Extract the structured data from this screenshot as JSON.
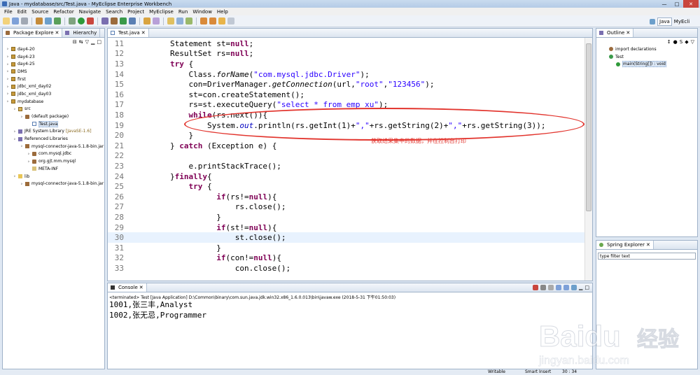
{
  "window": {
    "title": "Java - mydatabase/src/Test.java - MyEclipse Enterprise Workbench",
    "min": "—",
    "max": "□",
    "close": "✕"
  },
  "menu": [
    "File",
    "Edit",
    "Source",
    "Refactor",
    "Navigate",
    "Search",
    "Project",
    "MyEclipse",
    "Run",
    "Window",
    "Help"
  ],
  "perspectives": {
    "java": "Java",
    "myeclipse": "MyEcli"
  },
  "package_explorer": {
    "tabs": [
      "Package Explore",
      "Hierarchy"
    ],
    "items": [
      {
        "label": "day4-20",
        "type": "proj",
        "indent": 0
      },
      {
        "label": "day4-23",
        "type": "proj",
        "indent": 0
      },
      {
        "label": "day4-25",
        "type": "proj",
        "indent": 0
      },
      {
        "label": "DMS",
        "type": "proj",
        "indent": 0
      },
      {
        "label": "first",
        "type": "proj",
        "indent": 0
      },
      {
        "label": "jdbc_xml_day02",
        "type": "proj",
        "indent": 0
      },
      {
        "label": "jdbc_xml_day03",
        "type": "proj",
        "indent": 0
      },
      {
        "label": "mydatabase",
        "type": "proj",
        "indent": 0
      },
      {
        "label": "src",
        "type": "src",
        "indent": 1
      },
      {
        "label": "(default package)",
        "type": "pkg",
        "indent": 2
      },
      {
        "label": "Test.java",
        "type": "java",
        "indent": 3,
        "selected": true
      },
      {
        "label": "JRE System Library",
        "extra": "[JavaSE-1.6]",
        "type": "lib",
        "indent": 1
      },
      {
        "label": "Referenced Libraries",
        "type": "lib",
        "indent": 1
      },
      {
        "label": "mysql-connector-java-5.1.8-bin.jar",
        "type": "jar",
        "indent": 2
      },
      {
        "label": "com.mysql.jdbc",
        "type": "pkg",
        "indent": 3
      },
      {
        "label": "org.gjt.mm.mysql",
        "type": "pkg",
        "indent": 3
      },
      {
        "label": "META-INF",
        "type": "meta",
        "indent": 3
      },
      {
        "label": "lib",
        "type": "folder",
        "indent": 1
      },
      {
        "label": "mysql-connector-java-5.1.8-bin.jar",
        "type": "jar",
        "indent": 2
      }
    ]
  },
  "editor": {
    "tab": "Test.java",
    "annotation": "获取结果集中的数据，并在控制台打印",
    "current_line": 30,
    "lines": [
      {
        "n": "11",
        "parts": [
          {
            "t": "        Statement st="
          },
          {
            "t": "null",
            "c": "kw"
          },
          {
            "t": ";"
          }
        ]
      },
      {
        "n": "12",
        "parts": [
          {
            "t": "        ResultSet rs="
          },
          {
            "t": "null",
            "c": "kw"
          },
          {
            "t": ";"
          }
        ]
      },
      {
        "n": "13",
        "parts": [
          {
            "t": "        "
          },
          {
            "t": "try",
            "c": "kw"
          },
          {
            "t": " {"
          }
        ]
      },
      {
        "n": "14",
        "parts": [
          {
            "t": "            Class."
          },
          {
            "t": "forName",
            "c": "it"
          },
          {
            "t": "("
          },
          {
            "t": "\"com.mysql.jdbc.Driver\"",
            "c": "str"
          },
          {
            "t": ");"
          }
        ]
      },
      {
        "n": "15",
        "parts": [
          {
            "t": "            con=DriverManager."
          },
          {
            "t": "getConnection",
            "c": "it"
          },
          {
            "t": "(url,"
          },
          {
            "t": "\"root\"",
            "c": "str"
          },
          {
            "t": ","
          },
          {
            "t": "\"123456\"",
            "c": "str"
          },
          {
            "t": ");"
          }
        ]
      },
      {
        "n": "16",
        "parts": [
          {
            "t": "            st=con.createStatement();"
          }
        ]
      },
      {
        "n": "17",
        "parts": [
          {
            "t": "            rs=st.executeQuery("
          },
          {
            "t": "\"select * from emp_xu\"",
            "c": "str"
          },
          {
            "t": ");"
          }
        ]
      },
      {
        "n": "18",
        "parts": [
          {
            "t": "            "
          },
          {
            "t": "while",
            "c": "kw"
          },
          {
            "t": "(rs.next()){"
          }
        ]
      },
      {
        "n": "19",
        "parts": [
          {
            "t": "                System."
          },
          {
            "t": "out",
            "c": "field"
          },
          {
            "t": ".println(rs.getInt(1)+"
          },
          {
            "t": "\",\"",
            "c": "str"
          },
          {
            "t": "+rs.getString(2)+"
          },
          {
            "t": "\",\"",
            "c": "str"
          },
          {
            "t": "+rs.getString(3));"
          }
        ]
      },
      {
        "n": "20",
        "parts": [
          {
            "t": "            }"
          }
        ]
      },
      {
        "n": "21",
        "parts": [
          {
            "t": "        } "
          },
          {
            "t": "catch",
            "c": "kw"
          },
          {
            "t": " (Exception e) {"
          }
        ]
      },
      {
        "n": "22",
        "parts": [
          {
            "t": ""
          }
        ]
      },
      {
        "n": "23",
        "parts": [
          {
            "t": "            e.printStackTrace();"
          }
        ]
      },
      {
        "n": "24",
        "parts": [
          {
            "t": "        }"
          },
          {
            "t": "finally",
            "c": "kw"
          },
          {
            "t": "{"
          }
        ]
      },
      {
        "n": "25",
        "parts": [
          {
            "t": "            "
          },
          {
            "t": "try",
            "c": "kw"
          },
          {
            "t": " {"
          }
        ]
      },
      {
        "n": "26",
        "parts": [
          {
            "t": "                  "
          },
          {
            "t": "if",
            "c": "kw"
          },
          {
            "t": "(rs!="
          },
          {
            "t": "null",
            "c": "kw"
          },
          {
            "t": "){"
          }
        ]
      },
      {
        "n": "27",
        "parts": [
          {
            "t": "                      rs.close();"
          }
        ]
      },
      {
        "n": "28",
        "parts": [
          {
            "t": "                  }"
          }
        ]
      },
      {
        "n": "29",
        "parts": [
          {
            "t": "                  "
          },
          {
            "t": "if",
            "c": "kw"
          },
          {
            "t": "(st!="
          },
          {
            "t": "null",
            "c": "kw"
          },
          {
            "t": "){"
          }
        ]
      },
      {
        "n": "30",
        "parts": [
          {
            "t": "                      st.close();"
          }
        ]
      },
      {
        "n": "31",
        "parts": [
          {
            "t": "                  }"
          }
        ]
      },
      {
        "n": "32",
        "parts": [
          {
            "t": "                  "
          },
          {
            "t": "if",
            "c": "kw"
          },
          {
            "t": "(con!="
          },
          {
            "t": "null",
            "c": "kw"
          },
          {
            "t": "){"
          }
        ]
      },
      {
        "n": "33",
        "parts": [
          {
            "t": "                      con.close();"
          }
        ]
      }
    ]
  },
  "outline": {
    "tab": "Outline",
    "items": [
      {
        "label": "import declarations",
        "indent": 1
      },
      {
        "label": "Test",
        "indent": 1
      },
      {
        "label": "main(String[]) : void",
        "indent": 2,
        "selected": true
      }
    ]
  },
  "spring": {
    "tab": "Spring Explorer",
    "filter_placeholder": "type filter text"
  },
  "console": {
    "tab": "Console",
    "info": "<terminated> Test [Java Application] D:\\Common\\binary\\com.sun.java.jdk.win32.x86_1.6.0.013\\bin\\javaw.exe (2018-5-31 下午01:50:03)",
    "output": [
      "1001,张三丰,Analyst",
      "1002,张无忌,Programmer"
    ]
  },
  "status": {
    "writable": "Writable",
    "insert": "Smart Insert",
    "position": "30 : 34"
  },
  "watermark": {
    "brand": "Baidu",
    "brand_cn": "经验",
    "url": "jingyan.baidu.com"
  },
  "colors": {
    "keyword": "#7f0055",
    "string": "#2a00ff",
    "annotation": "#e2342d",
    "current_line": "#e8f2fe"
  }
}
